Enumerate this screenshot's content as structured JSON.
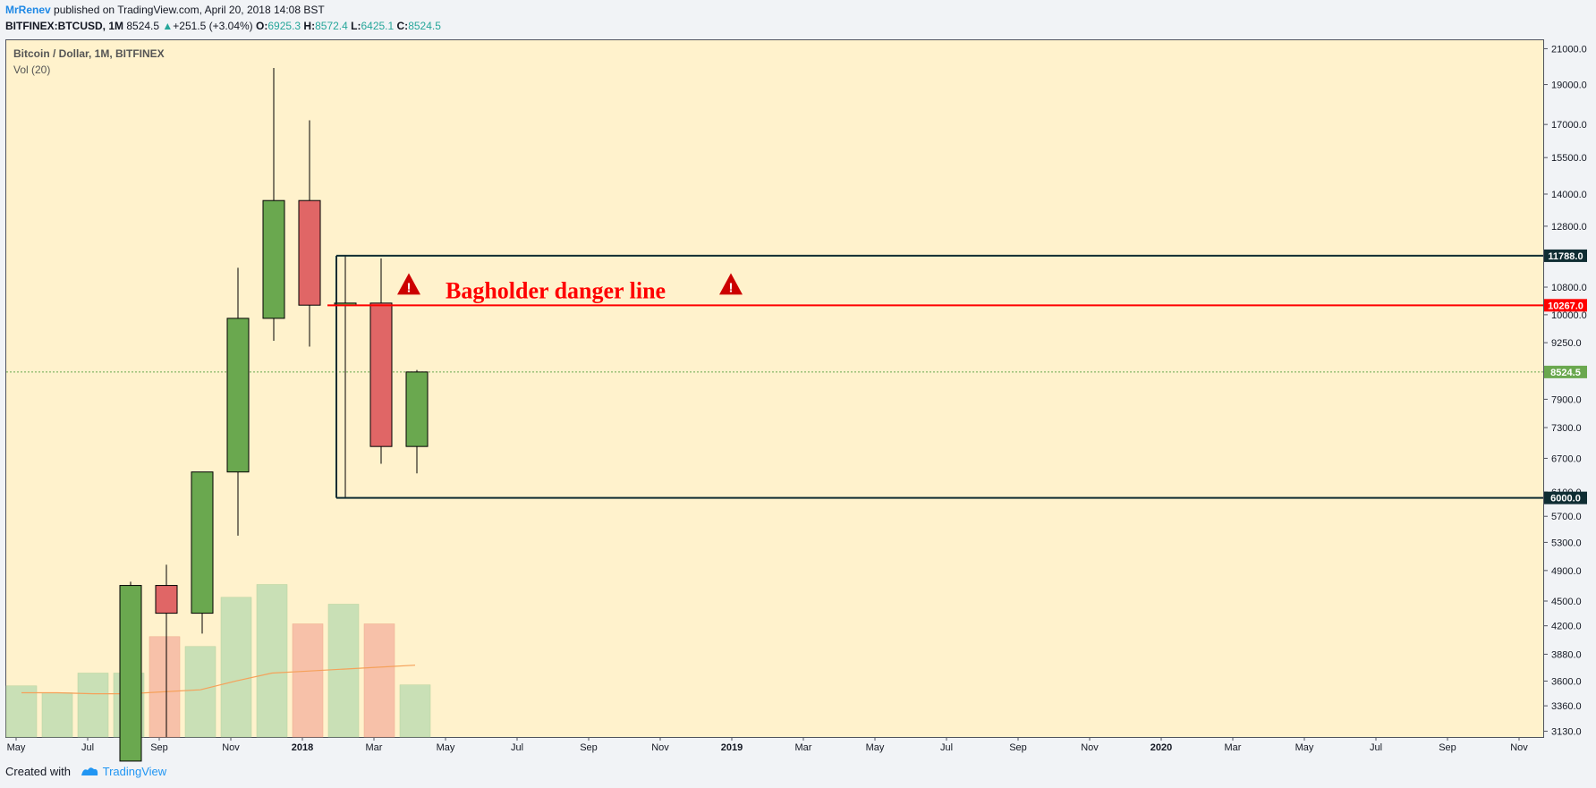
{
  "header": {
    "author": "MrRenev",
    "published": "published on TradingView.com, April 20, 2018 14:08 BST",
    "symbol": "BITFINEX:BTCUSD, 1M",
    "last": "8524.5",
    "change": "+251.5 (+3.04%)",
    "o_label": "O:",
    "o": "6925.3",
    "h_label": "H:",
    "h": "8572.4",
    "l_label": "L:",
    "l": "6425.1",
    "c_label": "C:",
    "c": "8524.5"
  },
  "chart_title": "Bitcoin / Dollar, 1M, BITFINEX",
  "vol_title": "Vol (20)",
  "footer": {
    "created_with": "Created with",
    "brand": "TradingView"
  },
  "colors": {
    "up": "#6aa84f",
    "down": "#e06666",
    "vol_up": "#c9e0b6",
    "vol_down": "#f7c1a9",
    "danger": "#ff0000",
    "box": "#0f2d33",
    "bg": "#fff2cc",
    "last": "#6aa84f"
  },
  "chart_data": {
    "type": "candlestick",
    "x_ticks": [
      "May",
      "Jul",
      "Sep",
      "Nov",
      "2018",
      "Mar",
      "May",
      "Jul",
      "Sep",
      "Nov",
      "2019",
      "Mar",
      "May",
      "Jul",
      "Sep",
      "Nov",
      "2020",
      "Mar",
      "May",
      "Jul",
      "Sep",
      "Nov"
    ],
    "y_ticks": [
      3130,
      3360,
      3600,
      3880,
      4200,
      4500,
      4900,
      5300,
      5700,
      6100,
      6700,
      7300,
      7900,
      8524.5,
      9250,
      10000,
      10800,
      11788,
      12800,
      14000,
      15500,
      17000,
      19000,
      21000
    ],
    "ylim": [
      3080,
      21500
    ],
    "y_scale": "log",
    "candles": [
      {
        "month": "Aug 2017",
        "open": 2880,
        "high": 4750,
        "low": 2700,
        "close": 4700,
        "dir": "up"
      },
      {
        "month": "Sep 2017",
        "open": 4700,
        "high": 4980,
        "low": 2980,
        "close": 4350,
        "dir": "down"
      },
      {
        "month": "Oct 2017",
        "open": 4350,
        "high": 6450,
        "low": 4110,
        "close": 6450,
        "dir": "up"
      },
      {
        "month": "Nov 2017",
        "open": 6450,
        "high": 11400,
        "low": 5400,
        "close": 9900,
        "dir": "up"
      },
      {
        "month": "Dec 2017",
        "open": 9900,
        "high": 19900,
        "low": 9300,
        "close": 13750,
        "dir": "up"
      },
      {
        "month": "Jan 2018",
        "open": 13750,
        "high": 17200,
        "low": 9150,
        "close": 10270,
        "dir": "down"
      },
      {
        "month": "Feb 2018",
        "open": 10270,
        "high": 11800,
        "low": 6000,
        "close": 10330,
        "dir": "up"
      },
      {
        "month": "Mar 2018",
        "open": 10330,
        "high": 11700,
        "low": 6600,
        "close": 6925,
        "dir": "down"
      },
      {
        "month": "Apr 2018",
        "open": 6925.3,
        "high": 8572.4,
        "low": 6425.1,
        "close": 8524.5,
        "dir": "up"
      }
    ],
    "volume": [
      {
        "dir": "up",
        "rel": 0.52
      },
      {
        "dir": "up",
        "rel": 0.45
      },
      {
        "dir": "up",
        "rel": 0.65
      },
      {
        "dir": "up",
        "rel": 0.65
      },
      {
        "dir": "down",
        "rel": 1.02
      },
      {
        "dir": "up",
        "rel": 0.92
      },
      {
        "dir": "up",
        "rel": 1.42
      },
      {
        "dir": "up",
        "rel": 1.55
      },
      {
        "dir": "down",
        "rel": 1.15
      },
      {
        "dir": "up",
        "rel": 1.35
      },
      {
        "dir": "down",
        "rel": 1.15
      },
      {
        "dir": "up",
        "rel": 0.53
      }
    ],
    "volume_ma": [
      0.45,
      0.45,
      0.44,
      0.44,
      0.46,
      0.48,
      0.57,
      0.65,
      0.67,
      0.69,
      0.71,
      0.73
    ],
    "annotations": {
      "danger_line": {
        "value": 10267.0,
        "label": "Bagholder danger line",
        "price_label": "10267.0"
      },
      "box_top": {
        "value": 11788.0,
        "price_label": "11788.0"
      },
      "box_bottom": {
        "value": 6000.0,
        "price_label": "6000.0"
      },
      "last_price": {
        "value": 8524.5,
        "price_label": "8524.5"
      }
    }
  }
}
